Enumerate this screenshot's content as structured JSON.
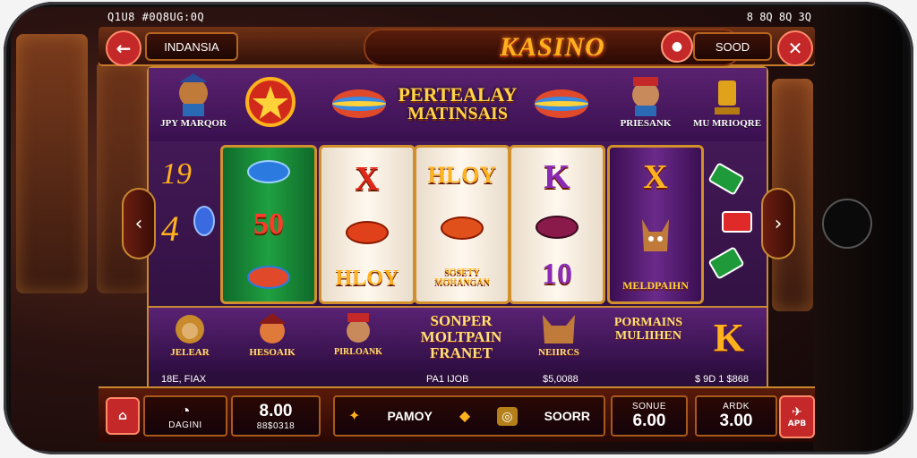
{
  "status_bar": {
    "left": "Q1U8 #0Q8UG:0Q",
    "right": "8 8Q 8Q 3Q"
  },
  "header": {
    "back_icon": "←",
    "region_label": "INDANSIA",
    "logo": "KASINO",
    "sound_label": "SOOD",
    "close_icon": "✕"
  },
  "top_symbols": [
    {
      "label": "JPY MARQOR"
    },
    {
      "label": ""
    },
    {
      "label": ""
    },
    {
      "label": ""
    },
    {
      "label": "PRIESANK"
    },
    {
      "label": "MU MRIOQRE"
    }
  ],
  "title_banner": {
    "line1": "PERTEALAY",
    "line2": "MATINSAIS"
  },
  "left_paytable": {
    "row1": "19",
    "row2": "4"
  },
  "reels": [
    {
      "type": "green",
      "symbols": [
        "",
        "50",
        ""
      ]
    },
    {
      "type": "cream",
      "symbols": [
        "X",
        "",
        "HLOY"
      ]
    },
    {
      "type": "cream",
      "symbols": [
        "HLOY",
        "",
        "SOSETY MOHANGAN"
      ]
    },
    {
      "type": "cream",
      "symbols": [
        "K",
        "",
        "10"
      ]
    },
    {
      "type": "purple",
      "symbols": [
        "X",
        "",
        "MELDPAIHN"
      ]
    }
  ],
  "bottom_symbols": [
    {
      "label": "JELEAR"
    },
    {
      "label": "HESOAIK"
    },
    {
      "label": "PIRLOANK"
    },
    {
      "label": "SONPER MOLTPAIN FRANET"
    },
    {
      "label": "NEIIRCS"
    },
    {
      "label": "PORMAINS MULIIHEN"
    },
    {
      "label": "K"
    }
  ],
  "values_row": [
    "18E, FIAX",
    "PA1 IJOB",
    "$5,0088",
    "$ 9D 1 $868"
  ],
  "controls": {
    "home_label": "",
    "machine_label": "DAGINI",
    "amount_value": "8.00",
    "amount_sub": "88$0318",
    "paytable_label": "PAMOY",
    "score_label": "SOORR",
    "bonus_label": "SONUE",
    "bonus_value": "6.00",
    "win_label": "ARDK",
    "win_value": "3.00",
    "app_label": "APB"
  },
  "colors": {
    "gold": "#ffb21e",
    "accent_red": "#c42828",
    "panel_purple": "#4a1c5e"
  }
}
